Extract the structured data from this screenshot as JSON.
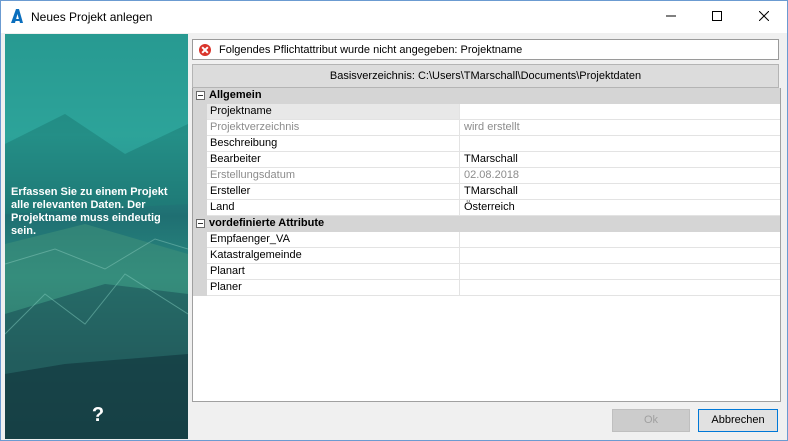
{
  "window": {
    "title": "Neues Projekt anlegen",
    "icon": "autodesk-a-icon"
  },
  "left_panel": {
    "text": "Erfassen Sie zu einem Projekt alle relevanten Daten. Der Projektname muss eindeutig sein.",
    "help": "?"
  },
  "error": {
    "icon": "error-circle-icon",
    "text": "Folgendes Pflichtattribut wurde nicht angegeben: Projektname"
  },
  "basis": {
    "text": "Basisverzeichnis: C:\\Users\\TMarschall\\Documents\\Projektdaten"
  },
  "grid": {
    "categories": [
      {
        "label": "Allgemein",
        "rows": [
          {
            "name": "Projektname",
            "value": "",
            "disabled": false
          },
          {
            "name": "Projektverzeichnis",
            "value": "wird erstellt",
            "disabled": true
          },
          {
            "name": "Beschreibung",
            "value": "",
            "disabled": false
          },
          {
            "name": "Bearbeiter",
            "value": "TMarschall",
            "disabled": false
          },
          {
            "name": "Erstellungsdatum",
            "value": "02.08.2018",
            "disabled": true
          },
          {
            "name": "Ersteller",
            "value": "TMarschall",
            "disabled": false
          },
          {
            "name": "Land",
            "value": "Österreich",
            "disabled": false
          }
        ]
      },
      {
        "label": "vordefinierte Attribute",
        "rows": [
          {
            "name": "Empfaenger_VA",
            "value": "",
            "disabled": false
          },
          {
            "name": "Katastralgemeinde",
            "value": "",
            "disabled": false
          },
          {
            "name": "Planart",
            "value": "",
            "disabled": false
          },
          {
            "name": "Planer",
            "value": "",
            "disabled": false
          }
        ]
      }
    ]
  },
  "buttons": {
    "ok": "Ok",
    "cancel": "Abbrechen"
  }
}
